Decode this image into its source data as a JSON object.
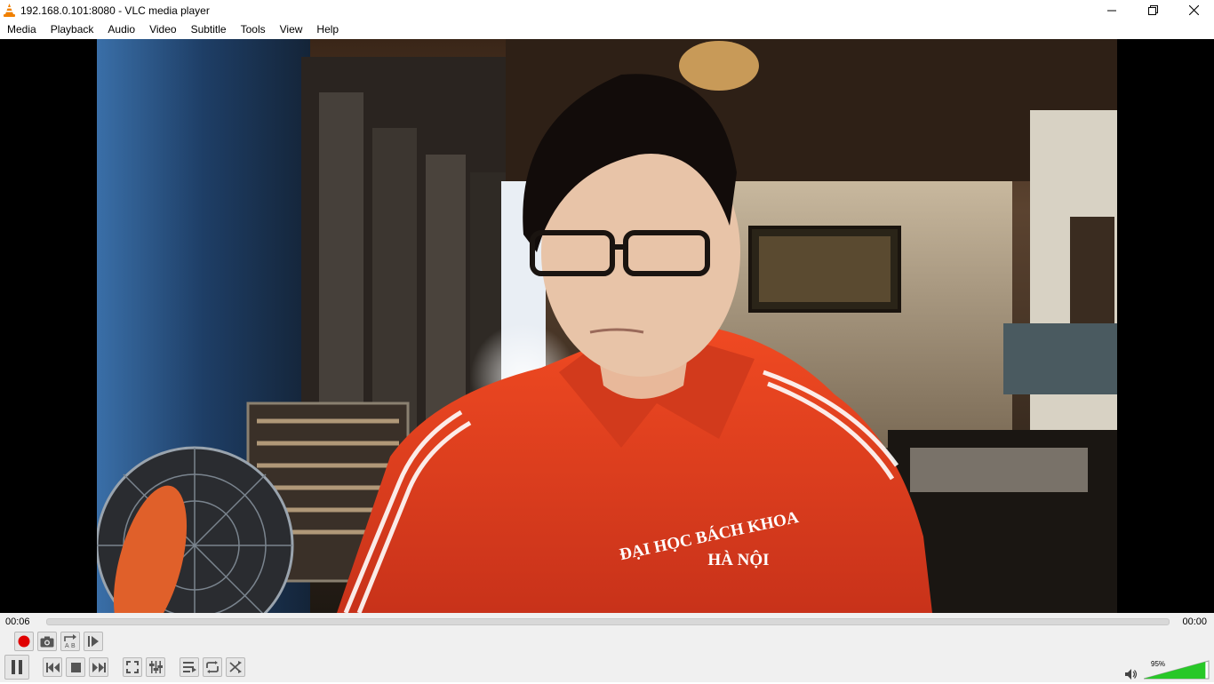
{
  "window": {
    "title": "192.168.0.101:8080 - VLC media player",
    "app_icon": "vlc-cone-icon",
    "controls": [
      "minimize-icon",
      "restore-icon",
      "close-icon"
    ]
  },
  "menu": [
    "Media",
    "Playback",
    "Audio",
    "Video",
    "Subtitle",
    "Tools",
    "View",
    "Help"
  ],
  "video": {
    "shirt_text_line1": "ĐẠI HỌC BÁCH KHOA",
    "shirt_text_line2": "HÀ NỘI"
  },
  "seek": {
    "elapsed": "00:06",
    "total": "00:00",
    "progress": 0
  },
  "controls": {
    "advanced": [
      "record-icon",
      "snapshot-icon",
      "loop-ab-icon",
      "frame-step-icon"
    ],
    "main": [
      "pause-icon",
      "previous-icon",
      "stop-icon",
      "next-icon",
      "fullscreen-icon",
      "extended-settings-icon",
      "playlist-icon",
      "loop-icon",
      "shuffle-icon"
    ]
  },
  "volume": {
    "label": "95%",
    "level": 0.95,
    "icon": "speaker-icon"
  },
  "colors": {
    "vlc_orange": "#f08000",
    "record_red": "#e00000",
    "volume_green": "#28c828",
    "shirt_red": "#e03a1a"
  }
}
